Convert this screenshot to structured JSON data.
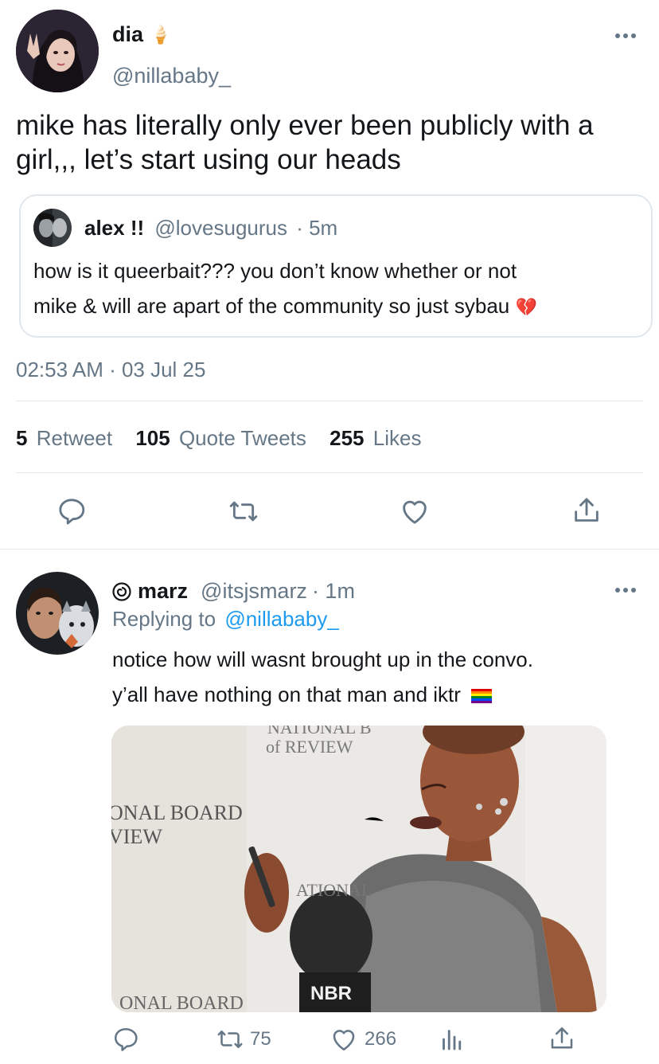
{
  "main_tweet": {
    "author": {
      "name": "dia",
      "name_emoji": "🍦",
      "handle": "@nillababy_",
      "avatar_icon": "user-avatar-photo"
    },
    "text_line1": "mike has literally only ever been publicly with a",
    "text_line2": "girl,,, let’s start using our heads",
    "quoted": {
      "name": "alex !!",
      "handle": "@lovesugurus",
      "time": "· 5m",
      "text_line1": "how is it queerbait??? you don’t know whether or not",
      "text_line2": "mike & will are apart of the community so just sybau",
      "emoji": "💔"
    },
    "timestamp": "02:53 AM · 03 Jul 25",
    "stats": {
      "retweets": "5",
      "retweets_label": "Retweet",
      "quotes": "105",
      "quotes_label": "Quote Tweets",
      "likes": "255",
      "likes_label": "Likes"
    },
    "actions": [
      "reply-icon",
      "retweet-icon",
      "like-icon",
      "share-icon"
    ]
  },
  "reply": {
    "author": {
      "name": "marz",
      "name_prefix_icon": "spiral-icon",
      "handle": "@itsjsmarz",
      "time": "· 1m"
    },
    "replying_label": "Replying to",
    "replying_to": "@nillababy_",
    "text_line1": "notice how will wasnt brought up in the convo.",
    "text_line2": "y’all have nothing on that man and iktr",
    "text_emoji": "🏳️‍🌈",
    "media": {
      "backdrop_text_1": "NATIONAL B",
      "backdrop_text_2": "of REVIEW",
      "backdrop_text_3": "ONAL BOARD",
      "backdrop_text_4": "VIEW",
      "backdrop_text_5": "ATIONAL",
      "backdrop_text_6": "ONAL BOARD",
      "mic_text": "NBR"
    },
    "counts": {
      "retweets": "75",
      "likes": "266"
    }
  },
  "colors": {
    "accent": "#1d9bf0",
    "muted": "#657786",
    "divider": "#e1e8ed"
  }
}
